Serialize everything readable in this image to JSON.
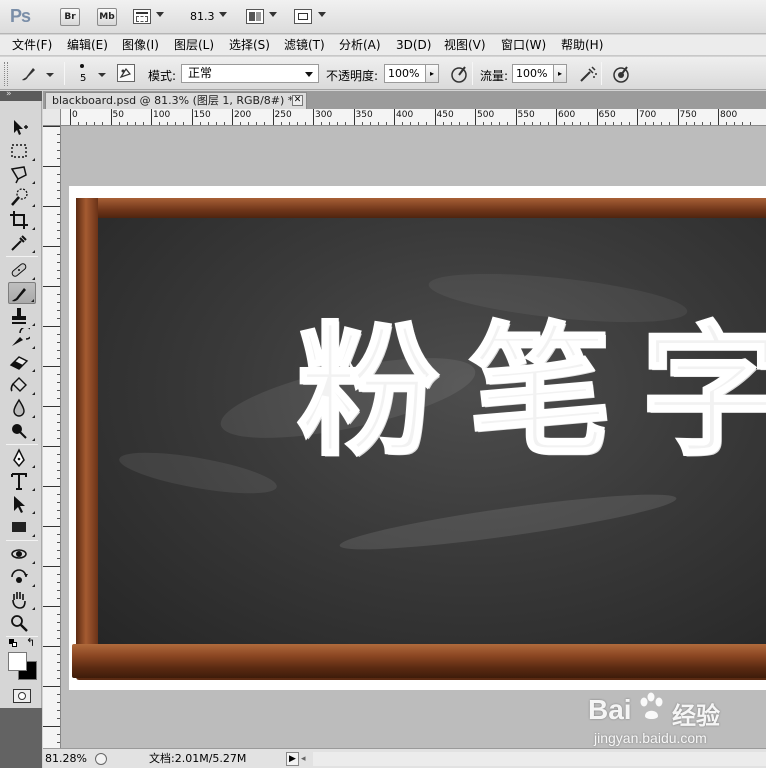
{
  "titlebar": {
    "logo": "Ps",
    "buttons": [
      {
        "name": "bridge-button",
        "label": "Br"
      },
      {
        "name": "minibridge-button",
        "label": "Mb"
      }
    ],
    "zoom_value": "81.3"
  },
  "menu": [
    "文件(F)",
    "编辑(E)",
    "图像(I)",
    "图层(L)",
    "选择(S)",
    "滤镜(T)",
    "分析(A)",
    "3D(D)",
    "视图(V)",
    "窗口(W)",
    "帮助(H)"
  ],
  "options": {
    "brush_size": "5",
    "mode_label": "模式:",
    "mode_value": "正常",
    "opacity_label": "不透明度:",
    "opacity_value": "100%",
    "flow_label": "流量:",
    "flow_value": "100%"
  },
  "document": {
    "tab_title": "blackboard.psd @ 81.3% (图层 1, RGB/8#) *",
    "close_glyph": "✕",
    "chalk_text": "粉笔字"
  },
  "ruler": {
    "h_labels": [
      "0",
      "50",
      "100",
      "150",
      "200",
      "250",
      "300",
      "350",
      "400",
      "450",
      "500",
      "550",
      "600",
      "650",
      "700",
      "750",
      "800"
    ]
  },
  "status": {
    "zoom": "81.28%",
    "doc_info": "文档:2.01M/5.27M"
  },
  "watermark": {
    "brand": "Bai",
    "brand_cn": "经验",
    "url": "jingyan.baidu.com"
  }
}
